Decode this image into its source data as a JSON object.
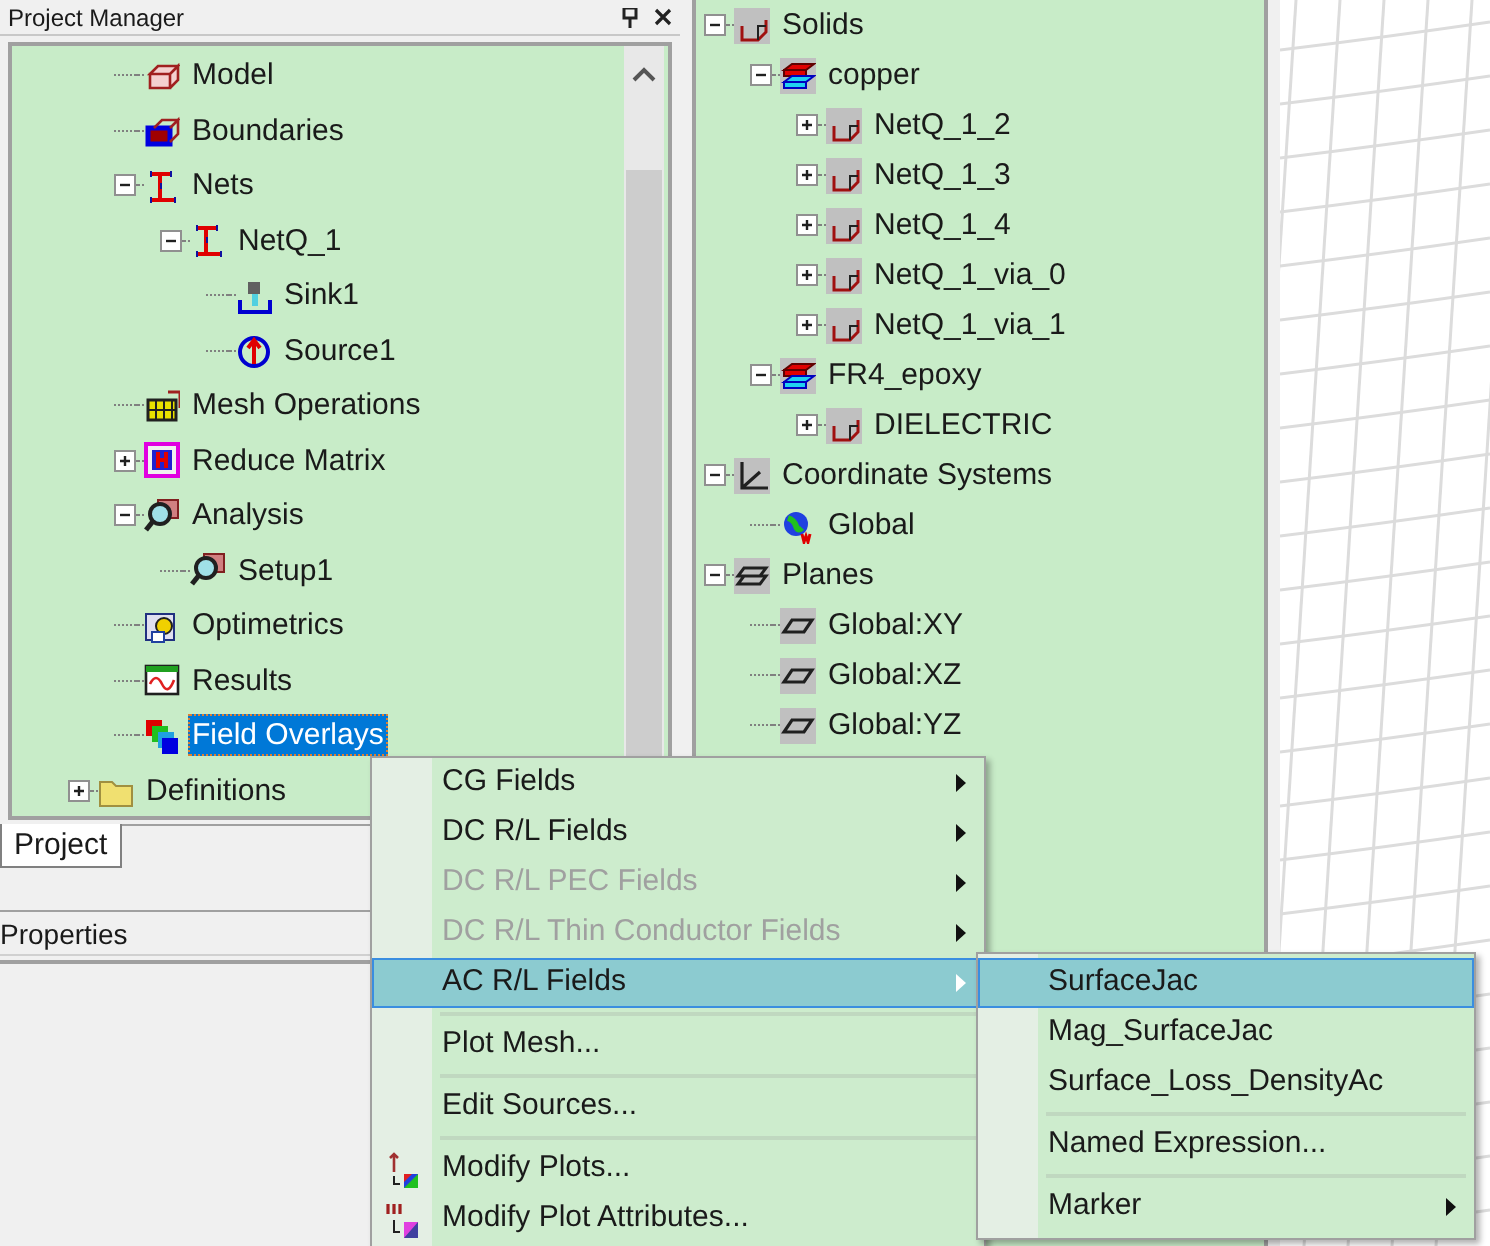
{
  "project_manager": {
    "title": "Project Manager",
    "tree": [
      {
        "children": [
          {
            "label": "Model",
            "kind": "model",
            "selected": false
          },
          {
            "label": "Boundaries",
            "kind": "boundaries",
            "selected": false
          },
          {
            "label": "Nets",
            "kind": "net",
            "expanded": true,
            "selected": false,
            "children": [
              {
                "label": "NetQ_1",
                "kind": "net",
                "expanded": true,
                "selected": false,
                "children": [
                  {
                    "label": "Sink1",
                    "kind": "sink",
                    "selected": false
                  },
                  {
                    "label": "Source1",
                    "kind": "source",
                    "selected": false
                  }
                ]
              }
            ]
          },
          {
            "label": "Mesh Operations",
            "kind": "mesh",
            "selected": false
          },
          {
            "label": "Reduce Matrix",
            "kind": "matrix",
            "expanded": false,
            "selected": false
          },
          {
            "label": "Analysis",
            "kind": "analysis",
            "expanded": true,
            "selected": false,
            "children": [
              {
                "label": "Setup1",
                "kind": "analysis",
                "selected": false
              }
            ]
          },
          {
            "label": "Optimetrics",
            "kind": "optimetrics",
            "selected": false
          },
          {
            "label": "Results",
            "kind": "results",
            "selected": false
          },
          {
            "label": "Field Overlays",
            "kind": "overlays",
            "selected": true
          }
        ]
      },
      {
        "label": "Definitions",
        "kind": "folder",
        "expanded": false,
        "selected": false
      }
    ],
    "tabs": [
      {
        "label": "Project",
        "selected": true
      }
    ]
  },
  "properties": {
    "title": "Properties"
  },
  "model_tree": [
    {
      "label": "Solids",
      "kind": "solid",
      "expanded": true,
      "children": [
        {
          "label": "copper",
          "kind": "material",
          "expanded": true,
          "children": [
            {
              "label": "NetQ_1_2",
              "kind": "solid",
              "expanded": false
            },
            {
              "label": "NetQ_1_3",
              "kind": "solid",
              "expanded": false
            },
            {
              "label": "NetQ_1_4",
              "kind": "solid",
              "expanded": false
            },
            {
              "label": "NetQ_1_via_0",
              "kind": "solid",
              "expanded": false
            },
            {
              "label": "NetQ_1_via_1",
              "kind": "solid",
              "expanded": false
            }
          ]
        },
        {
          "label": "FR4_epoxy",
          "kind": "material",
          "expanded": true,
          "children": [
            {
              "label": "DIELECTRIC",
              "kind": "solid",
              "expanded": false
            }
          ]
        }
      ]
    },
    {
      "label": "Coordinate Systems",
      "kind": "axes",
      "expanded": true,
      "children": [
        {
          "label": "Global",
          "kind": "globe"
        }
      ]
    },
    {
      "label": "Planes",
      "kind": "planes",
      "expanded": true,
      "children": [
        {
          "label": "Global:XY",
          "kind": "plane"
        },
        {
          "label": "Global:XZ",
          "kind": "plane"
        },
        {
          "label": "Global:YZ",
          "kind": "plane"
        }
      ]
    }
  ],
  "context_menu": {
    "groups": [
      [
        {
          "label": "CG Fields",
          "disabled": false,
          "selected": false,
          "submenu": true
        },
        {
          "label": "DC R/L Fields",
          "disabled": false,
          "selected": false,
          "submenu": true
        },
        {
          "label": "DC R/L PEC Fields",
          "disabled": true,
          "selected": false,
          "submenu": true
        },
        {
          "label": "DC R/L Thin Conductor Fields",
          "disabled": true,
          "selected": false,
          "submenu": true
        },
        {
          "label": "AC R/L Fields",
          "disabled": false,
          "selected": true,
          "submenu": true
        }
      ],
      [
        {
          "label": "Plot Mesh...",
          "disabled": false,
          "selected": false,
          "submenu": false
        }
      ],
      [
        {
          "label": "Edit Sources...",
          "disabled": false,
          "selected": false,
          "submenu": false
        }
      ],
      [
        {
          "label": "Modify Plots...",
          "disabled": false,
          "selected": false,
          "submenu": false
        },
        {
          "label": "Modify Plot Attributes...",
          "disabled": false,
          "selected": false,
          "submenu": false
        }
      ]
    ]
  },
  "submenu": {
    "groups": [
      [
        {
          "label": "SurfaceJac",
          "disabled": false,
          "selected": true,
          "submenu": false
        },
        {
          "label": "Mag_SurfaceJac",
          "disabled": false,
          "selected": false,
          "submenu": false
        },
        {
          "label": "Surface_Loss_DensityAc",
          "disabled": false,
          "selected": false,
          "submenu": false
        }
      ],
      [
        {
          "label": "Named Expression...",
          "disabled": false,
          "selected": false,
          "submenu": false
        }
      ],
      [
        {
          "label": "Marker",
          "disabled": false,
          "selected": false,
          "submenu": true
        }
      ]
    ]
  }
}
